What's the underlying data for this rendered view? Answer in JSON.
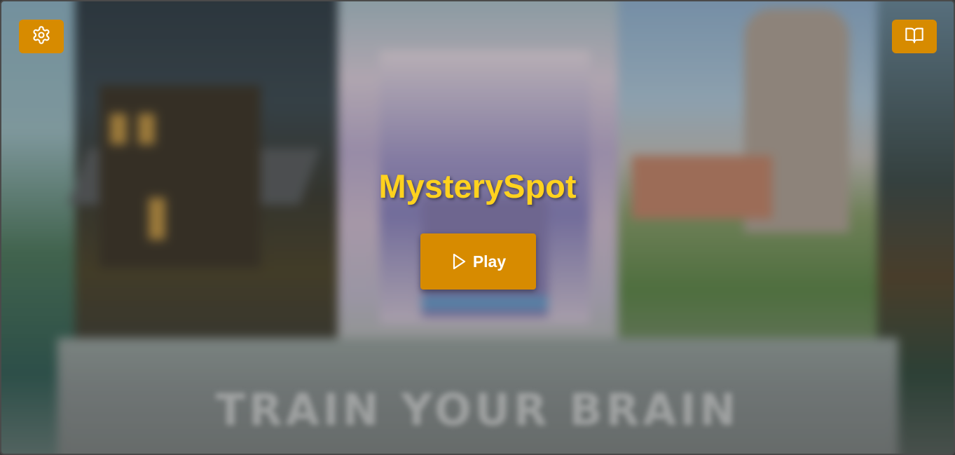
{
  "app": {
    "title": "MysterySpot",
    "tagline": "TRAIN YOUR BRAIN"
  },
  "buttons": {
    "play_label": "Play",
    "settings_icon": "gear-icon",
    "instructions_icon": "book-icon",
    "play_icon": "play-icon"
  },
  "colors": {
    "accent": "#d78b00",
    "title": "#ffd21e",
    "button_text": "#ffffff"
  }
}
